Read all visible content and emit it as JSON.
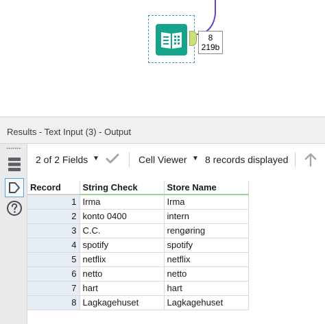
{
  "canvas": {
    "tool_name": "text-input-tool",
    "badge": {
      "records": "8",
      "size": "219b"
    }
  },
  "results": {
    "title": "Results - Text Input (3) - Output",
    "toolbar": {
      "fields_label": "2 of 2 Fields",
      "viewer_label": "Cell Viewer",
      "records_label": "8 records displayed"
    },
    "columns": [
      "Record",
      "String Check",
      "Store Name"
    ],
    "rows": [
      {
        "record": "1",
        "string_check": "Irma",
        "store_name": "Irma"
      },
      {
        "record": "2",
        "string_check": "konto 0400",
        "store_name": "intern"
      },
      {
        "record": "3",
        "string_check": "C.C.",
        "store_name": "rengøring"
      },
      {
        "record": "4",
        "string_check": "spotify",
        "store_name": "spotify"
      },
      {
        "record": "5",
        "string_check": "netflix",
        "store_name": "netflix"
      },
      {
        "record": "6",
        "string_check": "netto",
        "store_name": "netto"
      },
      {
        "record": "7",
        "string_check": "hart",
        "store_name": "hart"
      },
      {
        "record": "8",
        "string_check": "Lagkagehuset",
        "store_name": "Lagkagehuset"
      }
    ]
  },
  "colors": {
    "tool_green": "#15a48a",
    "anchor_green": "#cbe07c",
    "connector_purple": "#6a3fc9",
    "selection_blue": "#3b8fc9"
  },
  "icons": [
    "text-input-book-icon",
    "table-view-icon",
    "tag-icon",
    "help-icon",
    "checkmark-icon",
    "scroll-up-arrow-icon",
    "caret-down-icon"
  ]
}
